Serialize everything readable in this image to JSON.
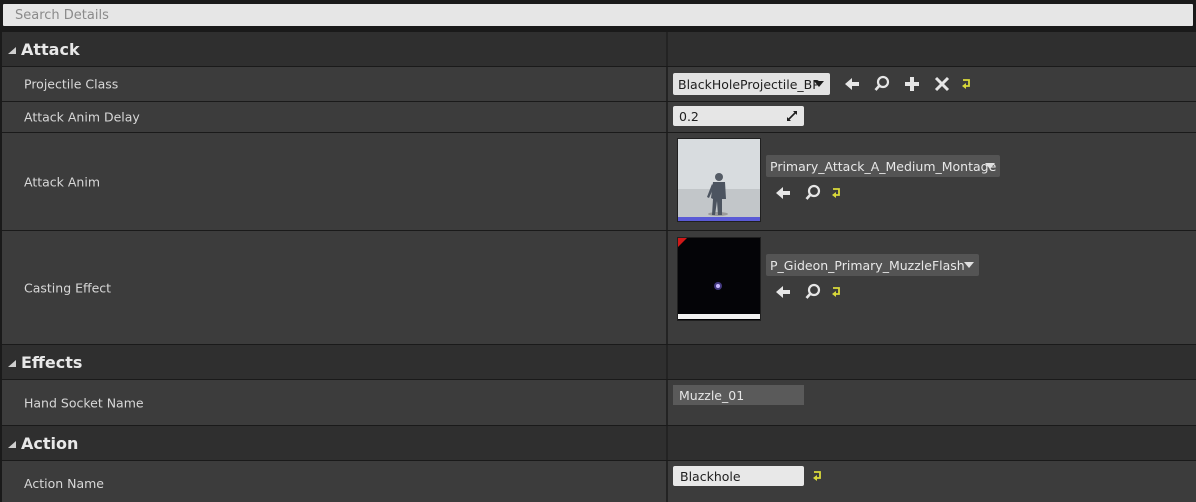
{
  "search": {
    "placeholder": "Search Details"
  },
  "categories": {
    "attack": {
      "title": "Attack"
    },
    "effects": {
      "title": "Effects"
    },
    "action": {
      "title": "Action"
    }
  },
  "properties": {
    "projectile_class": {
      "label": "Projectile Class",
      "value": "BlackHoleProjectile_BP"
    },
    "attack_anim_delay": {
      "label": "Attack Anim Delay",
      "value": "0.2"
    },
    "attack_anim": {
      "label": "Attack Anim",
      "value": "Primary_Attack_A_Medium_Montage"
    },
    "casting_effect": {
      "label": "Casting Effect",
      "value": "P_Gideon_Primary_MuzzleFlash"
    },
    "hand_socket_name": {
      "label": "Hand Socket Name",
      "value": "Muzzle_01"
    },
    "action_name": {
      "label": "Action Name",
      "value": "Blackhole"
    }
  },
  "colors": {
    "reset_arrow": "#d9d93a",
    "anim_bar": "#5a5ad6"
  }
}
